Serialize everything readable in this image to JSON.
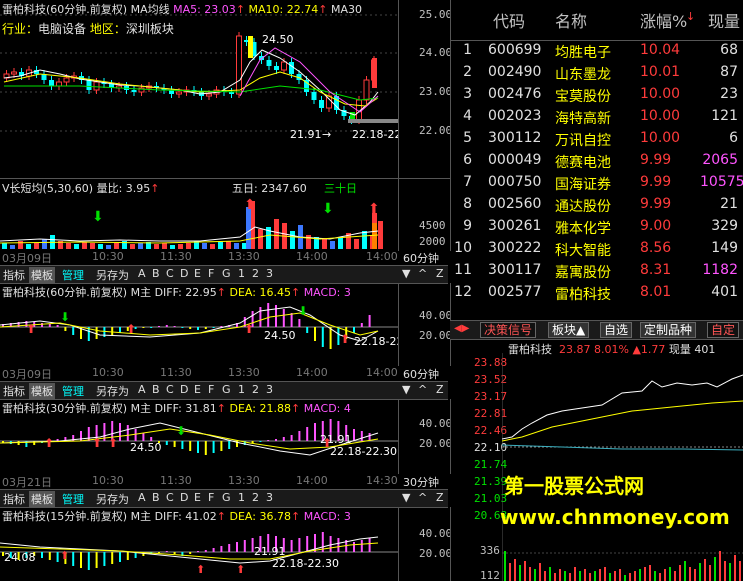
{
  "main_chart": {
    "title": "雷柏科技(60分钟.前复权)",
    "ma_label": "MA均线",
    "ma5": "MA5: 23.03",
    "ma10": "MA10: 22.74",
    "ma30": "MA30",
    "industry_label": "行业：",
    "industry_value": "电脑设备",
    "region_label": "地区：",
    "region_value": "深圳板块",
    "high_price": "24.50",
    "low_price": "21.91",
    "low_range": "22.18-22",
    "y_ticks": [
      "25.00",
      "24.00",
      "23.00",
      "22.00"
    ]
  },
  "volume_chart": {
    "indicator": "V长短均(5,30,60)",
    "ratio_label": "量比: 3.95",
    "five_day": "五日: 2347.60",
    "thirty_day": "三十日",
    "y_ticks": [
      "4500",
      "2000"
    ]
  },
  "date_bars": [
    {
      "start": "03月09日",
      "times": [
        "10:30",
        "11:30",
        "13:30",
        "14:00",
        "11:30",
        "13:30",
        "14:00"
      ],
      "period": "60分钟"
    },
    {
      "start": "03月09日",
      "times": [
        "10:30",
        "11:30",
        "13:30",
        "14:00",
        "11:30",
        "13:30",
        "14:00"
      ],
      "period": "60分钟"
    },
    {
      "start": "03月21日",
      "times": [
        "10:30",
        "11:30",
        "13:30",
        "14:00",
        "11:30",
        "13:30",
        "14:30"
      ],
      "period": "30分钟"
    }
  ],
  "toolbar": {
    "items": [
      "指标",
      "模板",
      "管理",
      "另存为",
      "A",
      "B",
      "C",
      "D",
      "E",
      "F",
      "G",
      "1",
      "2",
      "3"
    ],
    "buttons": [
      "▼",
      "^",
      "Z"
    ]
  },
  "macd_panels": [
    {
      "title": "雷柏科技(60分钟.前复权) M主",
      "diff": "DIFF: 22.95",
      "dea": "DEA: 16.45",
      "macd": "MACD: 3",
      "labels": [
        "24.50",
        "22.18-22"
      ],
      "y_ticks": [
        "40.00",
        "20.00"
      ]
    },
    {
      "title": "雷柏科技(30分钟.前复权) M主",
      "diff": "DIFF: 31.81",
      "dea": "DEA: 21.88",
      "macd": "MACD: 4",
      "labels": [
        "24.50",
        "21.91",
        "22.18-22.30"
      ],
      "y_ticks": [
        "40.00",
        "20.00"
      ]
    },
    {
      "title": "雷柏科技(15分钟.前复权) M主",
      "diff": "DIFF: 41.02",
      "dea": "DEA: 36.78",
      "macd": "MACD: 3",
      "labels": [
        "24.08",
        "21.91",
        "22.18-22.30"
      ],
      "y_ticks": [
        "40.00",
        "20.00"
      ]
    }
  ],
  "stock_table": {
    "headers": {
      "code": "代码",
      "name": "名称",
      "change": "涨幅%",
      "volume": "现量"
    },
    "rows": [
      {
        "idx": "1",
        "code": "600699",
        "name": "均胜电子",
        "change": "10.04",
        "vol": "68"
      },
      {
        "idx": "2",
        "code": "002490",
        "name": "山东墨龙",
        "change": "10.01",
        "vol": "87"
      },
      {
        "idx": "3",
        "code": "002476",
        "name": "宝莫股份",
        "change": "10.00",
        "vol": "23"
      },
      {
        "idx": "4",
        "code": "002023",
        "name": "海特高新",
        "change": "10.00",
        "vol": "121"
      },
      {
        "idx": "5",
        "code": "300112",
        "name": "万讯自控",
        "change": "10.00",
        "vol": "6"
      },
      {
        "idx": "6",
        "code": "000049",
        "name": "德赛电池",
        "change": "9.99",
        "vol": "2065"
      },
      {
        "idx": "7",
        "code": "000750",
        "name": "国海证券",
        "change": "9.99",
        "vol": "10575"
      },
      {
        "idx": "8",
        "code": "002560",
        "name": "通达股份",
        "change": "9.99",
        "vol": "21"
      },
      {
        "idx": "9",
        "code": "300261",
        "name": "雅本化学",
        "change": "9.00",
        "vol": "329"
      },
      {
        "idx": "10",
        "code": "300222",
        "name": "科大智能",
        "change": "8.56",
        "vol": "149"
      },
      {
        "idx": "11",
        "code": "300117",
        "name": "嘉寓股份",
        "change": "8.31",
        "vol": "1182"
      },
      {
        "idx": "12",
        "code": "002577",
        "name": "雷柏科技",
        "change": "8.01",
        "vol": "401"
      }
    ]
  },
  "tabs": [
    "决策信号",
    "板块▲",
    "自选",
    "定制品种",
    "自定"
  ],
  "intraday": {
    "name": "雷柏科技",
    "price": "23.87",
    "pct": "8.01%",
    "delta": "▲1.77",
    "volume": "现量 401",
    "price_ticks": [
      "23.88",
      "23.52",
      "23.17",
      "22.81",
      "22.46",
      "22.10",
      "21.74",
      "21.39",
      "21.03",
      "20.68"
    ],
    "vol_ticks": [
      "336",
      "112"
    ]
  },
  "watermark": {
    "line1": "第一股票公式网",
    "line2": "www.chnmoney.com"
  },
  "colors": {
    "up": "#ff3b3b",
    "down": "#00ffff",
    "yellow": "#ffff00",
    "magenta": "#ff55ff"
  }
}
